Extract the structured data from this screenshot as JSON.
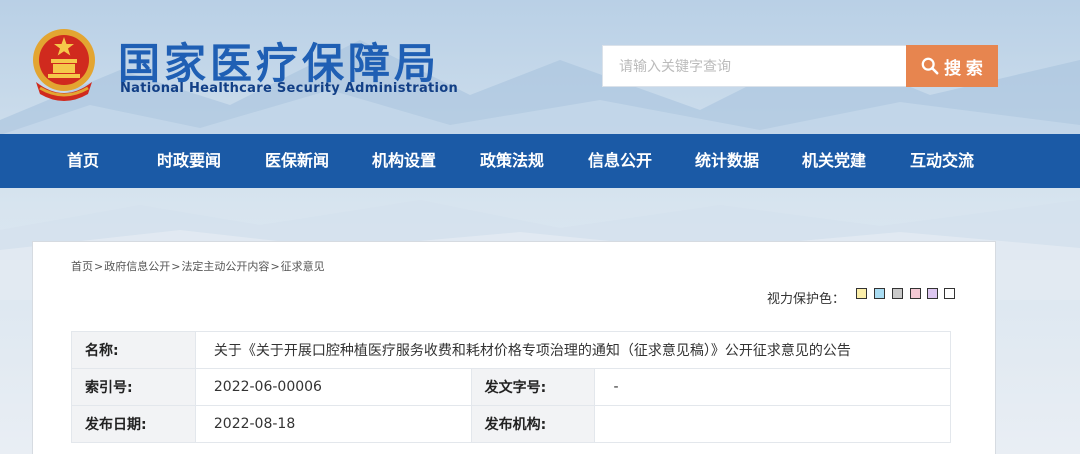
{
  "header": {
    "title": "国家医疗保障局",
    "subtitle": "National Healthcare Security Administration",
    "emblem_icon": "national-emblem-icon"
  },
  "search": {
    "placeholder": "请输入关键字查询",
    "value": "",
    "button_label": "搜 索",
    "button_icon": "search-icon",
    "button_color": "#e7854f"
  },
  "nav": {
    "color": "#1b5aa6",
    "items": [
      {
        "label": "首页"
      },
      {
        "label": "时政要闻"
      },
      {
        "label": "医保新闻"
      },
      {
        "label": "机构设置"
      },
      {
        "label": "政策法规"
      },
      {
        "label": "信息公开"
      },
      {
        "label": "统计数据"
      },
      {
        "label": "机关党建"
      },
      {
        "label": "互动交流"
      }
    ]
  },
  "breadcrumb": {
    "items": [
      "首页",
      "政府信息公开",
      "法定主动公开内容",
      "征求意见"
    ],
    "separator": ">"
  },
  "eye_protection": {
    "label": "视力保护色：",
    "swatches": [
      "#fcefaa",
      "#a9dcf2",
      "#c9c9c9",
      "#f4c9d4",
      "#dcc6f0",
      "#ffffff"
    ]
  },
  "info": {
    "name_label": "名称:",
    "name_value": "关于《关于开展口腔种植医疗服务收费和耗材价格专项治理的通知（征求意见稿）》公开征求意见的公告",
    "index_label": "索引号:",
    "index_value": "2022-06-00006",
    "doc_no_label": "发文字号:",
    "doc_no_value": "-",
    "date_label": "发布日期:",
    "date_value": "2022-08-18",
    "org_label": "发布机构:",
    "org_value": ""
  }
}
